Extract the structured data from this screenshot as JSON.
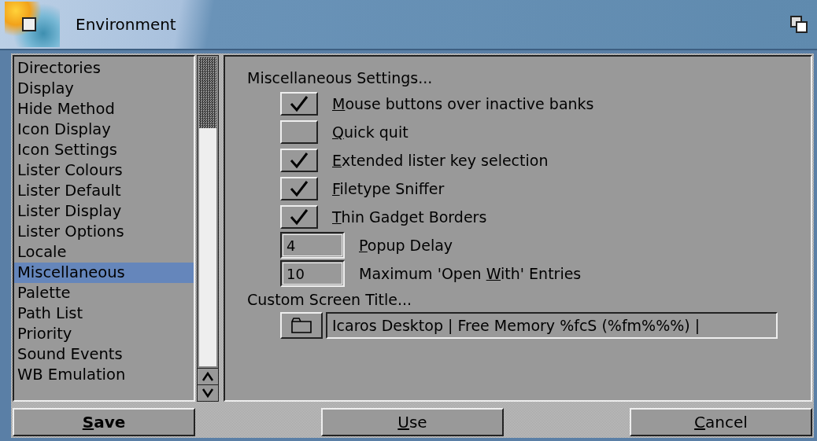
{
  "window": {
    "title": "Environment"
  },
  "sidebar": {
    "items": [
      {
        "label": "Directories",
        "selected": false
      },
      {
        "label": "Display",
        "selected": false
      },
      {
        "label": "Hide Method",
        "selected": false
      },
      {
        "label": "Icon Display",
        "selected": false
      },
      {
        "label": "Icon Settings",
        "selected": false
      },
      {
        "label": "Lister Colours",
        "selected": false
      },
      {
        "label": "Lister Default",
        "selected": false
      },
      {
        "label": "Lister Display",
        "selected": false
      },
      {
        "label": "Lister Options",
        "selected": false
      },
      {
        "label": "Locale",
        "selected": false
      },
      {
        "label": "Miscellaneous",
        "selected": true
      },
      {
        "label": "Palette",
        "selected": false
      },
      {
        "label": "Path List",
        "selected": false
      },
      {
        "label": "Priority",
        "selected": false
      },
      {
        "label": "Sound Events",
        "selected": false
      },
      {
        "label": "WB Emulation",
        "selected": false
      }
    ]
  },
  "settings": {
    "heading": "Miscellaneous Settings...",
    "rows": [
      {
        "kind": "checkbox",
        "checked": true,
        "key": "M",
        "post": "ouse buttons over inactive banks"
      },
      {
        "kind": "checkbox",
        "checked": false,
        "key": "Q",
        "post": "uick quit"
      },
      {
        "kind": "checkbox",
        "checked": true,
        "key": "E",
        "post": "xtended lister key selection"
      },
      {
        "kind": "checkbox",
        "checked": true,
        "key": "F",
        "post": "iletype Sniffer"
      },
      {
        "kind": "checkbox",
        "checked": true,
        "key": "T",
        "post": "hin Gadget Borders"
      },
      {
        "kind": "number",
        "value": "4",
        "key": "P",
        "post": "opup Delay"
      },
      {
        "kind": "number",
        "value": "10",
        "pre": "Maximum 'Open ",
        "key": "W",
        "post": "ith' Entries"
      }
    ],
    "title_heading": "Custom Screen Title...",
    "title_value": "Icaros Desktop | Free Memory %fcS (%fm%%%) |"
  },
  "buttons": [
    {
      "key": "S",
      "post": "ave",
      "bold": true
    },
    {
      "key": "U",
      "post": "se",
      "bold": false
    },
    {
      "key": "C",
      "post": "ancel",
      "bold": false
    }
  ]
}
